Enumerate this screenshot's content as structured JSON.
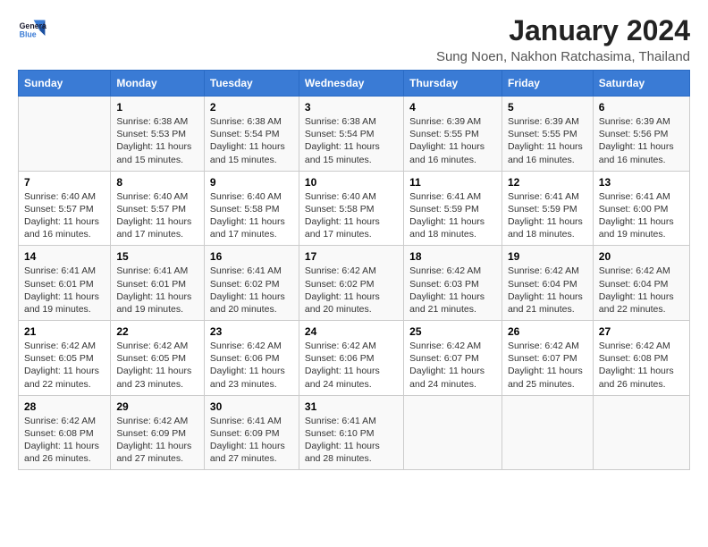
{
  "logo": {
    "line1": "General",
    "line2": "Blue"
  },
  "title": "January 2024",
  "subtitle": "Sung Noen, Nakhon Ratchasima, Thailand",
  "headers": [
    "Sunday",
    "Monday",
    "Tuesday",
    "Wednesday",
    "Thursday",
    "Friday",
    "Saturday"
  ],
  "weeks": [
    [
      {
        "day": "",
        "sunrise": "",
        "sunset": "",
        "daylight": ""
      },
      {
        "day": "1",
        "sunrise": "Sunrise: 6:38 AM",
        "sunset": "Sunset: 5:53 PM",
        "daylight": "Daylight: 11 hours and 15 minutes."
      },
      {
        "day": "2",
        "sunrise": "Sunrise: 6:38 AM",
        "sunset": "Sunset: 5:54 PM",
        "daylight": "Daylight: 11 hours and 15 minutes."
      },
      {
        "day": "3",
        "sunrise": "Sunrise: 6:38 AM",
        "sunset": "Sunset: 5:54 PM",
        "daylight": "Daylight: 11 hours and 15 minutes."
      },
      {
        "day": "4",
        "sunrise": "Sunrise: 6:39 AM",
        "sunset": "Sunset: 5:55 PM",
        "daylight": "Daylight: 11 hours and 16 minutes."
      },
      {
        "day": "5",
        "sunrise": "Sunrise: 6:39 AM",
        "sunset": "Sunset: 5:55 PM",
        "daylight": "Daylight: 11 hours and 16 minutes."
      },
      {
        "day": "6",
        "sunrise": "Sunrise: 6:39 AM",
        "sunset": "Sunset: 5:56 PM",
        "daylight": "Daylight: 11 hours and 16 minutes."
      }
    ],
    [
      {
        "day": "7",
        "sunrise": "Sunrise: 6:40 AM",
        "sunset": "Sunset: 5:57 PM",
        "daylight": "Daylight: 11 hours and 16 minutes."
      },
      {
        "day": "8",
        "sunrise": "Sunrise: 6:40 AM",
        "sunset": "Sunset: 5:57 PM",
        "daylight": "Daylight: 11 hours and 17 minutes."
      },
      {
        "day": "9",
        "sunrise": "Sunrise: 6:40 AM",
        "sunset": "Sunset: 5:58 PM",
        "daylight": "Daylight: 11 hours and 17 minutes."
      },
      {
        "day": "10",
        "sunrise": "Sunrise: 6:40 AM",
        "sunset": "Sunset: 5:58 PM",
        "daylight": "Daylight: 11 hours and 17 minutes."
      },
      {
        "day": "11",
        "sunrise": "Sunrise: 6:41 AM",
        "sunset": "Sunset: 5:59 PM",
        "daylight": "Daylight: 11 hours and 18 minutes."
      },
      {
        "day": "12",
        "sunrise": "Sunrise: 6:41 AM",
        "sunset": "Sunset: 5:59 PM",
        "daylight": "Daylight: 11 hours and 18 minutes."
      },
      {
        "day": "13",
        "sunrise": "Sunrise: 6:41 AM",
        "sunset": "Sunset: 6:00 PM",
        "daylight": "Daylight: 11 hours and 19 minutes."
      }
    ],
    [
      {
        "day": "14",
        "sunrise": "Sunrise: 6:41 AM",
        "sunset": "Sunset: 6:01 PM",
        "daylight": "Daylight: 11 hours and 19 minutes."
      },
      {
        "day": "15",
        "sunrise": "Sunrise: 6:41 AM",
        "sunset": "Sunset: 6:01 PM",
        "daylight": "Daylight: 11 hours and 19 minutes."
      },
      {
        "day": "16",
        "sunrise": "Sunrise: 6:41 AM",
        "sunset": "Sunset: 6:02 PM",
        "daylight": "Daylight: 11 hours and 20 minutes."
      },
      {
        "day": "17",
        "sunrise": "Sunrise: 6:42 AM",
        "sunset": "Sunset: 6:02 PM",
        "daylight": "Daylight: 11 hours and 20 minutes."
      },
      {
        "day": "18",
        "sunrise": "Sunrise: 6:42 AM",
        "sunset": "Sunset: 6:03 PM",
        "daylight": "Daylight: 11 hours and 21 minutes."
      },
      {
        "day": "19",
        "sunrise": "Sunrise: 6:42 AM",
        "sunset": "Sunset: 6:04 PM",
        "daylight": "Daylight: 11 hours and 21 minutes."
      },
      {
        "day": "20",
        "sunrise": "Sunrise: 6:42 AM",
        "sunset": "Sunset: 6:04 PM",
        "daylight": "Daylight: 11 hours and 22 minutes."
      }
    ],
    [
      {
        "day": "21",
        "sunrise": "Sunrise: 6:42 AM",
        "sunset": "Sunset: 6:05 PM",
        "daylight": "Daylight: 11 hours and 22 minutes."
      },
      {
        "day": "22",
        "sunrise": "Sunrise: 6:42 AM",
        "sunset": "Sunset: 6:05 PM",
        "daylight": "Daylight: 11 hours and 23 minutes."
      },
      {
        "day": "23",
        "sunrise": "Sunrise: 6:42 AM",
        "sunset": "Sunset: 6:06 PM",
        "daylight": "Daylight: 11 hours and 23 minutes."
      },
      {
        "day": "24",
        "sunrise": "Sunrise: 6:42 AM",
        "sunset": "Sunset: 6:06 PM",
        "daylight": "Daylight: 11 hours and 24 minutes."
      },
      {
        "day": "25",
        "sunrise": "Sunrise: 6:42 AM",
        "sunset": "Sunset: 6:07 PM",
        "daylight": "Daylight: 11 hours and 24 minutes."
      },
      {
        "day": "26",
        "sunrise": "Sunrise: 6:42 AM",
        "sunset": "Sunset: 6:07 PM",
        "daylight": "Daylight: 11 hours and 25 minutes."
      },
      {
        "day": "27",
        "sunrise": "Sunrise: 6:42 AM",
        "sunset": "Sunset: 6:08 PM",
        "daylight": "Daylight: 11 hours and 26 minutes."
      }
    ],
    [
      {
        "day": "28",
        "sunrise": "Sunrise: 6:42 AM",
        "sunset": "Sunset: 6:08 PM",
        "daylight": "Daylight: 11 hours and 26 minutes."
      },
      {
        "day": "29",
        "sunrise": "Sunrise: 6:42 AM",
        "sunset": "Sunset: 6:09 PM",
        "daylight": "Daylight: 11 hours and 27 minutes."
      },
      {
        "day": "30",
        "sunrise": "Sunrise: 6:41 AM",
        "sunset": "Sunset: 6:09 PM",
        "daylight": "Daylight: 11 hours and 27 minutes."
      },
      {
        "day": "31",
        "sunrise": "Sunrise: 6:41 AM",
        "sunset": "Sunset: 6:10 PM",
        "daylight": "Daylight: 11 hours and 28 minutes."
      },
      {
        "day": "",
        "sunrise": "",
        "sunset": "",
        "daylight": ""
      },
      {
        "day": "",
        "sunrise": "",
        "sunset": "",
        "daylight": ""
      },
      {
        "day": "",
        "sunrise": "",
        "sunset": "",
        "daylight": ""
      }
    ]
  ]
}
